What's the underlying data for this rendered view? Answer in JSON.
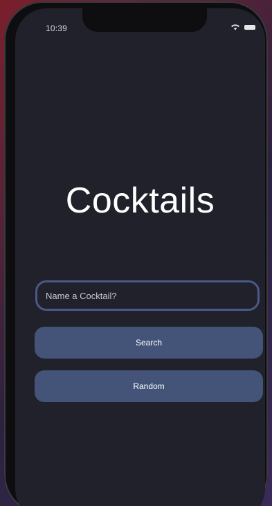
{
  "status_bar": {
    "time": "10:39",
    "wifi_icon": "wifi-icon",
    "battery_icon": "battery-icon"
  },
  "main": {
    "title": "Cocktails",
    "search": {
      "value": "",
      "placeholder": "Name a Cocktail?"
    },
    "search_button_label": "Search",
    "random_button_label": "Random"
  },
  "colors": {
    "screen_background": "#20212a",
    "button_background": "#445479",
    "input_border": "#4a5a88",
    "text": "#ffffff"
  }
}
